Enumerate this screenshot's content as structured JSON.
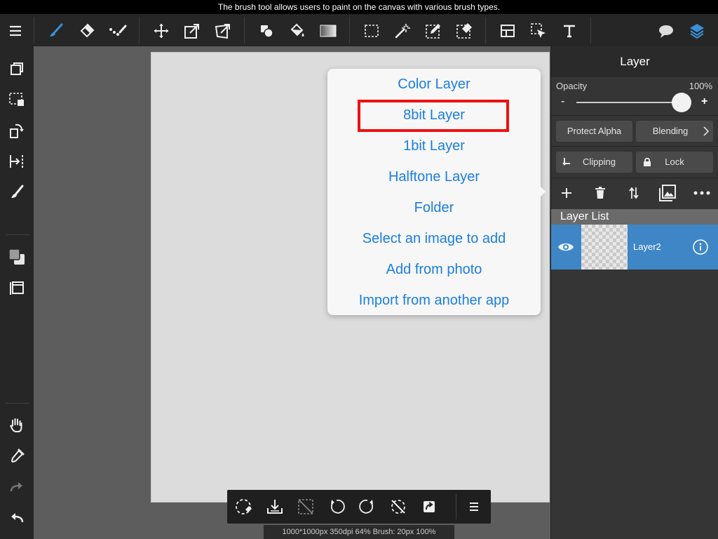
{
  "tooltip": "The brush tool allows users to paint on the canvas with various brush types.",
  "top_toolbar": {
    "icons": [
      "menu-icon",
      "brush-icon",
      "eraser-icon",
      "dot-brush-icon",
      "move-icon",
      "transform-icon",
      "distort-icon",
      "shape-fill-icon",
      "bucket-icon",
      "gradient-icon",
      "marquee-select-icon",
      "magic-wand-icon",
      "select-pen-icon",
      "select-eraser-icon",
      "panel-layout-icon",
      "select-pointer-icon",
      "text-icon",
      "speech-bubble-icon",
      "layers-icon"
    ],
    "accent_color": "#3a8fd9"
  },
  "left_toolbar": {
    "icons": [
      "copy-layer-icon",
      "selection-icon",
      "rotate-icon",
      "flip-icon",
      "brush-settings-icon",
      "color-icon",
      "frame-icon",
      "hand-icon",
      "eyedropper-icon",
      "redo-icon",
      "undo-icon"
    ]
  },
  "popover": {
    "items": [
      "Color Layer",
      "8bit Layer",
      "1bit Layer",
      "Halftone Layer",
      "Folder",
      "Select an image to add",
      "Add from photo",
      "Import from another app"
    ],
    "highlighted_item": "8bit Layer",
    "link_color": "#1a7ee0",
    "highlight_color": "#ee1111"
  },
  "layer_panel": {
    "title": "Layer",
    "opacity_label": "Opacity",
    "opacity_value": "100%",
    "opacity_fraction": 1.0,
    "minus": "-",
    "plus": "+",
    "protect_alpha": "Protect Alpha",
    "blending": "Blending",
    "clipping": "Clipping",
    "lock": "Lock",
    "layer_list_title": "Layer List",
    "layers": [
      {
        "name": "Layer2",
        "visible": true,
        "selected": true
      }
    ],
    "selected_color": "#3f86c6"
  },
  "bottom_toolbar": {
    "icons": [
      "clear-selection-icon",
      "import-icon",
      "deselect-icon",
      "undo-rotate-icon",
      "redo-rotate-icon",
      "reset-rotation-icon",
      "share-icon",
      "more-menu-icon"
    ]
  },
  "status": "1000*1000px 350dpi 64% Brush: 20px 100%"
}
